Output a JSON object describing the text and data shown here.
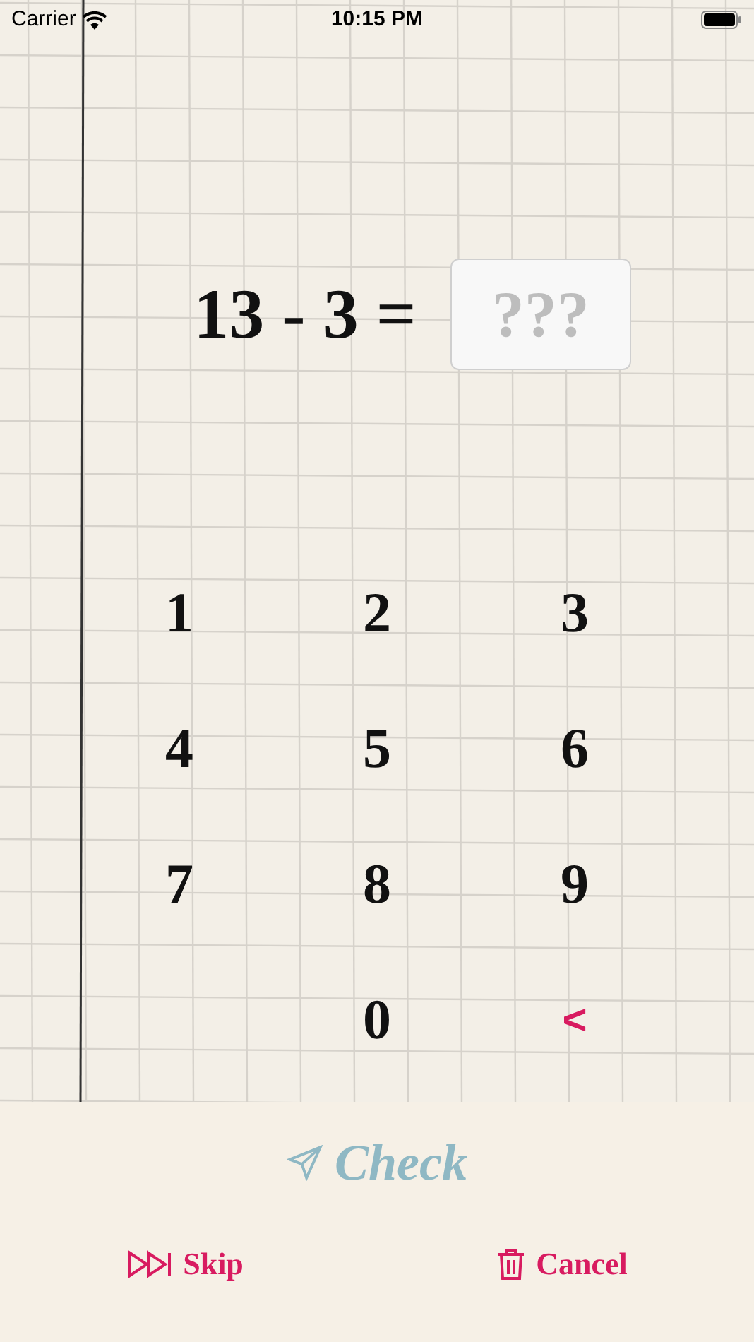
{
  "status_bar": {
    "carrier": "Carrier",
    "time": "10:15 PM"
  },
  "equation": {
    "expression": "13 - 3 =",
    "answer_placeholder": "???"
  },
  "keypad": [
    {
      "label": "1",
      "kind": "digit"
    },
    {
      "label": "2",
      "kind": "digit"
    },
    {
      "label": "3",
      "kind": "digit"
    },
    {
      "label": "4",
      "kind": "digit"
    },
    {
      "label": "5",
      "kind": "digit"
    },
    {
      "label": "6",
      "kind": "digit"
    },
    {
      "label": "7",
      "kind": "digit"
    },
    {
      "label": "8",
      "kind": "digit"
    },
    {
      "label": "9",
      "kind": "digit"
    },
    {
      "kind": "blank"
    },
    {
      "label": "0",
      "kind": "digit"
    },
    {
      "label": "<",
      "kind": "backspace"
    }
  ],
  "check_button": {
    "label": "Check",
    "disabled": true
  },
  "actions": [
    {
      "label": "Skip",
      "kind": "skip"
    },
    {
      "label": "Cancel",
      "kind": "cancel"
    }
  ]
}
